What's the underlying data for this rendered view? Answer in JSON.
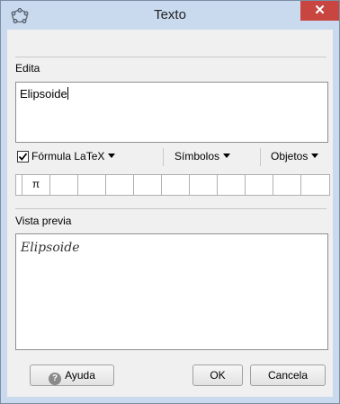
{
  "window": {
    "title": "Texto",
    "close_glyph": "✕"
  },
  "edit": {
    "label": "Edita",
    "content": "Elipsoide"
  },
  "toolbar": {
    "latex_checked": true,
    "latex_label": "Fórmula LaTeX",
    "symbols_label": "Símbolos",
    "objects_label": "Objetos"
  },
  "symbols": [
    "π",
    "",
    "",
    "",
    "",
    "",
    "",
    "",
    "",
    "",
    ""
  ],
  "preview": {
    "label": "Vista previa",
    "content": "Elipsoide"
  },
  "buttons": {
    "help_label": "Ayuda",
    "help_icon": "?",
    "ok_label": "OK",
    "cancel_label": "Cancela"
  },
  "icons": {
    "app": "geogebra-icon",
    "close": "close-icon",
    "help": "help-icon",
    "dropdown": "chevron-down-icon"
  },
  "colors": {
    "window_frame": "#c9daef",
    "close_button": "#c8463f",
    "panel": "#f0f0f0"
  }
}
